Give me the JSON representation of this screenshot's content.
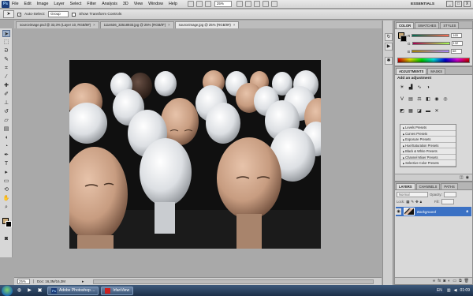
{
  "app": {
    "logo": "Ps",
    "menu": [
      "File",
      "Edit",
      "Image",
      "Layer",
      "Select",
      "Filter",
      "Analysis",
      "3D",
      "View",
      "Window",
      "Help"
    ],
    "zoom": "25%",
    "workspace": "ESSENTIALS",
    "window_controls": [
      "_",
      "□",
      "X"
    ]
  },
  "options_bar": {
    "auto_select_label": "Auto-Select:",
    "auto_select_value": "Group",
    "show_transform_label": "Show Transform Controls"
  },
  "doc_tabs": [
    {
      "label": "sourceimage.psd @ 33,3% (Layer 10, RGB/8#)",
      "close": "×"
    },
    {
      "label": "1114636_32518933.jpg @ 25% (RGB/8*)",
      "close": "×"
    },
    {
      "label": "sourceimage.jpg @ 25% (RGB/8#)",
      "close": "×"
    }
  ],
  "status_bar": {
    "zoom": "25%",
    "doc_info": "Doc: 16,3M/16,3M"
  },
  "color_panel": {
    "tabs": [
      "COLOR",
      "SWATCHES",
      "STYLES"
    ],
    "channels": [
      {
        "label": "R",
        "value": "165",
        "gradient": "linear-gradient(90deg,#006b52,#ff6b52)"
      },
      {
        "label": "G",
        "value": "132",
        "gradient": "linear-gradient(90deg,#a50052,#a5ff52)"
      },
      {
        "label": "B",
        "value": "68",
        "gradient": "linear-gradient(90deg,#a58400,#a584ff)"
      }
    ],
    "foreground": "#c8a978"
  },
  "adjustments_panel": {
    "tabs": [
      "ADJUSTMENTS",
      "MASKS"
    ],
    "add_label": "Add an adjustment",
    "presets": [
      "Levels Presets",
      "Curves Presets",
      "Exposure Presets",
      "Hue/Saturation Presets",
      "Black & White Presets",
      "Channel Mixer Presets",
      "Selective Color Presets"
    ]
  },
  "layers_panel": {
    "tabs": [
      "LAYERS",
      "CHANNELS",
      "PATHS"
    ],
    "blend_mode": "Normal",
    "opacity_label": "Opacity:",
    "lock_label": "Lock:",
    "fill_label": "Fill:",
    "layer_name": "Background"
  },
  "taskbar": {
    "tasks": [
      {
        "label": "Adobe Photoshop ...",
        "icon": "Ps"
      },
      {
        "label": "IrfanView",
        "icon": "iv"
      }
    ],
    "language": "EN",
    "time": "01:09"
  }
}
